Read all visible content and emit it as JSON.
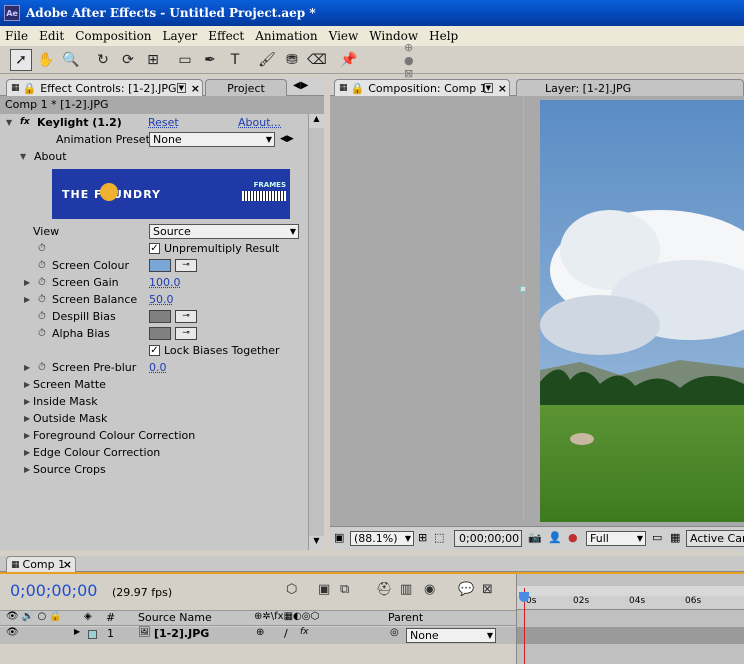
{
  "window": {
    "title": "Adobe After Effects - Untitled Project.aep *",
    "app_icon": "Ae"
  },
  "menu": [
    "File",
    "Edit",
    "Composition",
    "Layer",
    "Effect",
    "Animation",
    "View",
    "Window",
    "Help"
  ],
  "left_panel": {
    "tab_effect": "Effect Controls: [1-2].JPG",
    "tab_project": "Project",
    "crumb": "Comp 1 * [1-2].JPG",
    "effect_name": "Keylight (1.2)",
    "reset": "Reset",
    "about_link": "About...",
    "presets_label": "Animation Presets:",
    "presets_value": "None",
    "about_label": "About",
    "logo_text": "THE FOUNDRY",
    "logo_tag": "FRAMES",
    "view_label": "View",
    "view_value": "Source",
    "unpremult": "Unpremultiply Result",
    "screen_colour": "Screen Colour",
    "screen_colour_hex": "#7aa6d8",
    "screen_gain": "Screen Gain",
    "screen_gain_val": "100.0",
    "screen_balance": "Screen Balance",
    "screen_balance_val": "50.0",
    "despill_bias": "Despill Bias",
    "alpha_bias": "Alpha Bias",
    "lock_biases": "Lock Biases Together",
    "pre_blur": "Screen Pre-blur",
    "pre_blur_val": "0.0",
    "groups": [
      "Screen Matte",
      "Inside Mask",
      "Outside Mask",
      "Foreground Colour Correction",
      "Edge Colour Correction",
      "Source Crops"
    ]
  },
  "right_panel": {
    "tab_comp": "Composition: Comp 1",
    "tab_layer": "Layer: [1-2].JPG",
    "zoom": "(88.1%)",
    "timecode": "0;00;00;00",
    "resolution": "Full",
    "camera": "Active Cam"
  },
  "timeline": {
    "tab": "Comp 1",
    "timecode": "0;00;00;00",
    "fps": "(29.97 fps)",
    "col_num": "#",
    "col_source": "Source Name",
    "col_parent": "Parent",
    "layer_num": "1",
    "layer_name": "[1-2].JPG",
    "parent_value": "None",
    "ruler": [
      "0s",
      "02s",
      "04s",
      "06s"
    ]
  }
}
